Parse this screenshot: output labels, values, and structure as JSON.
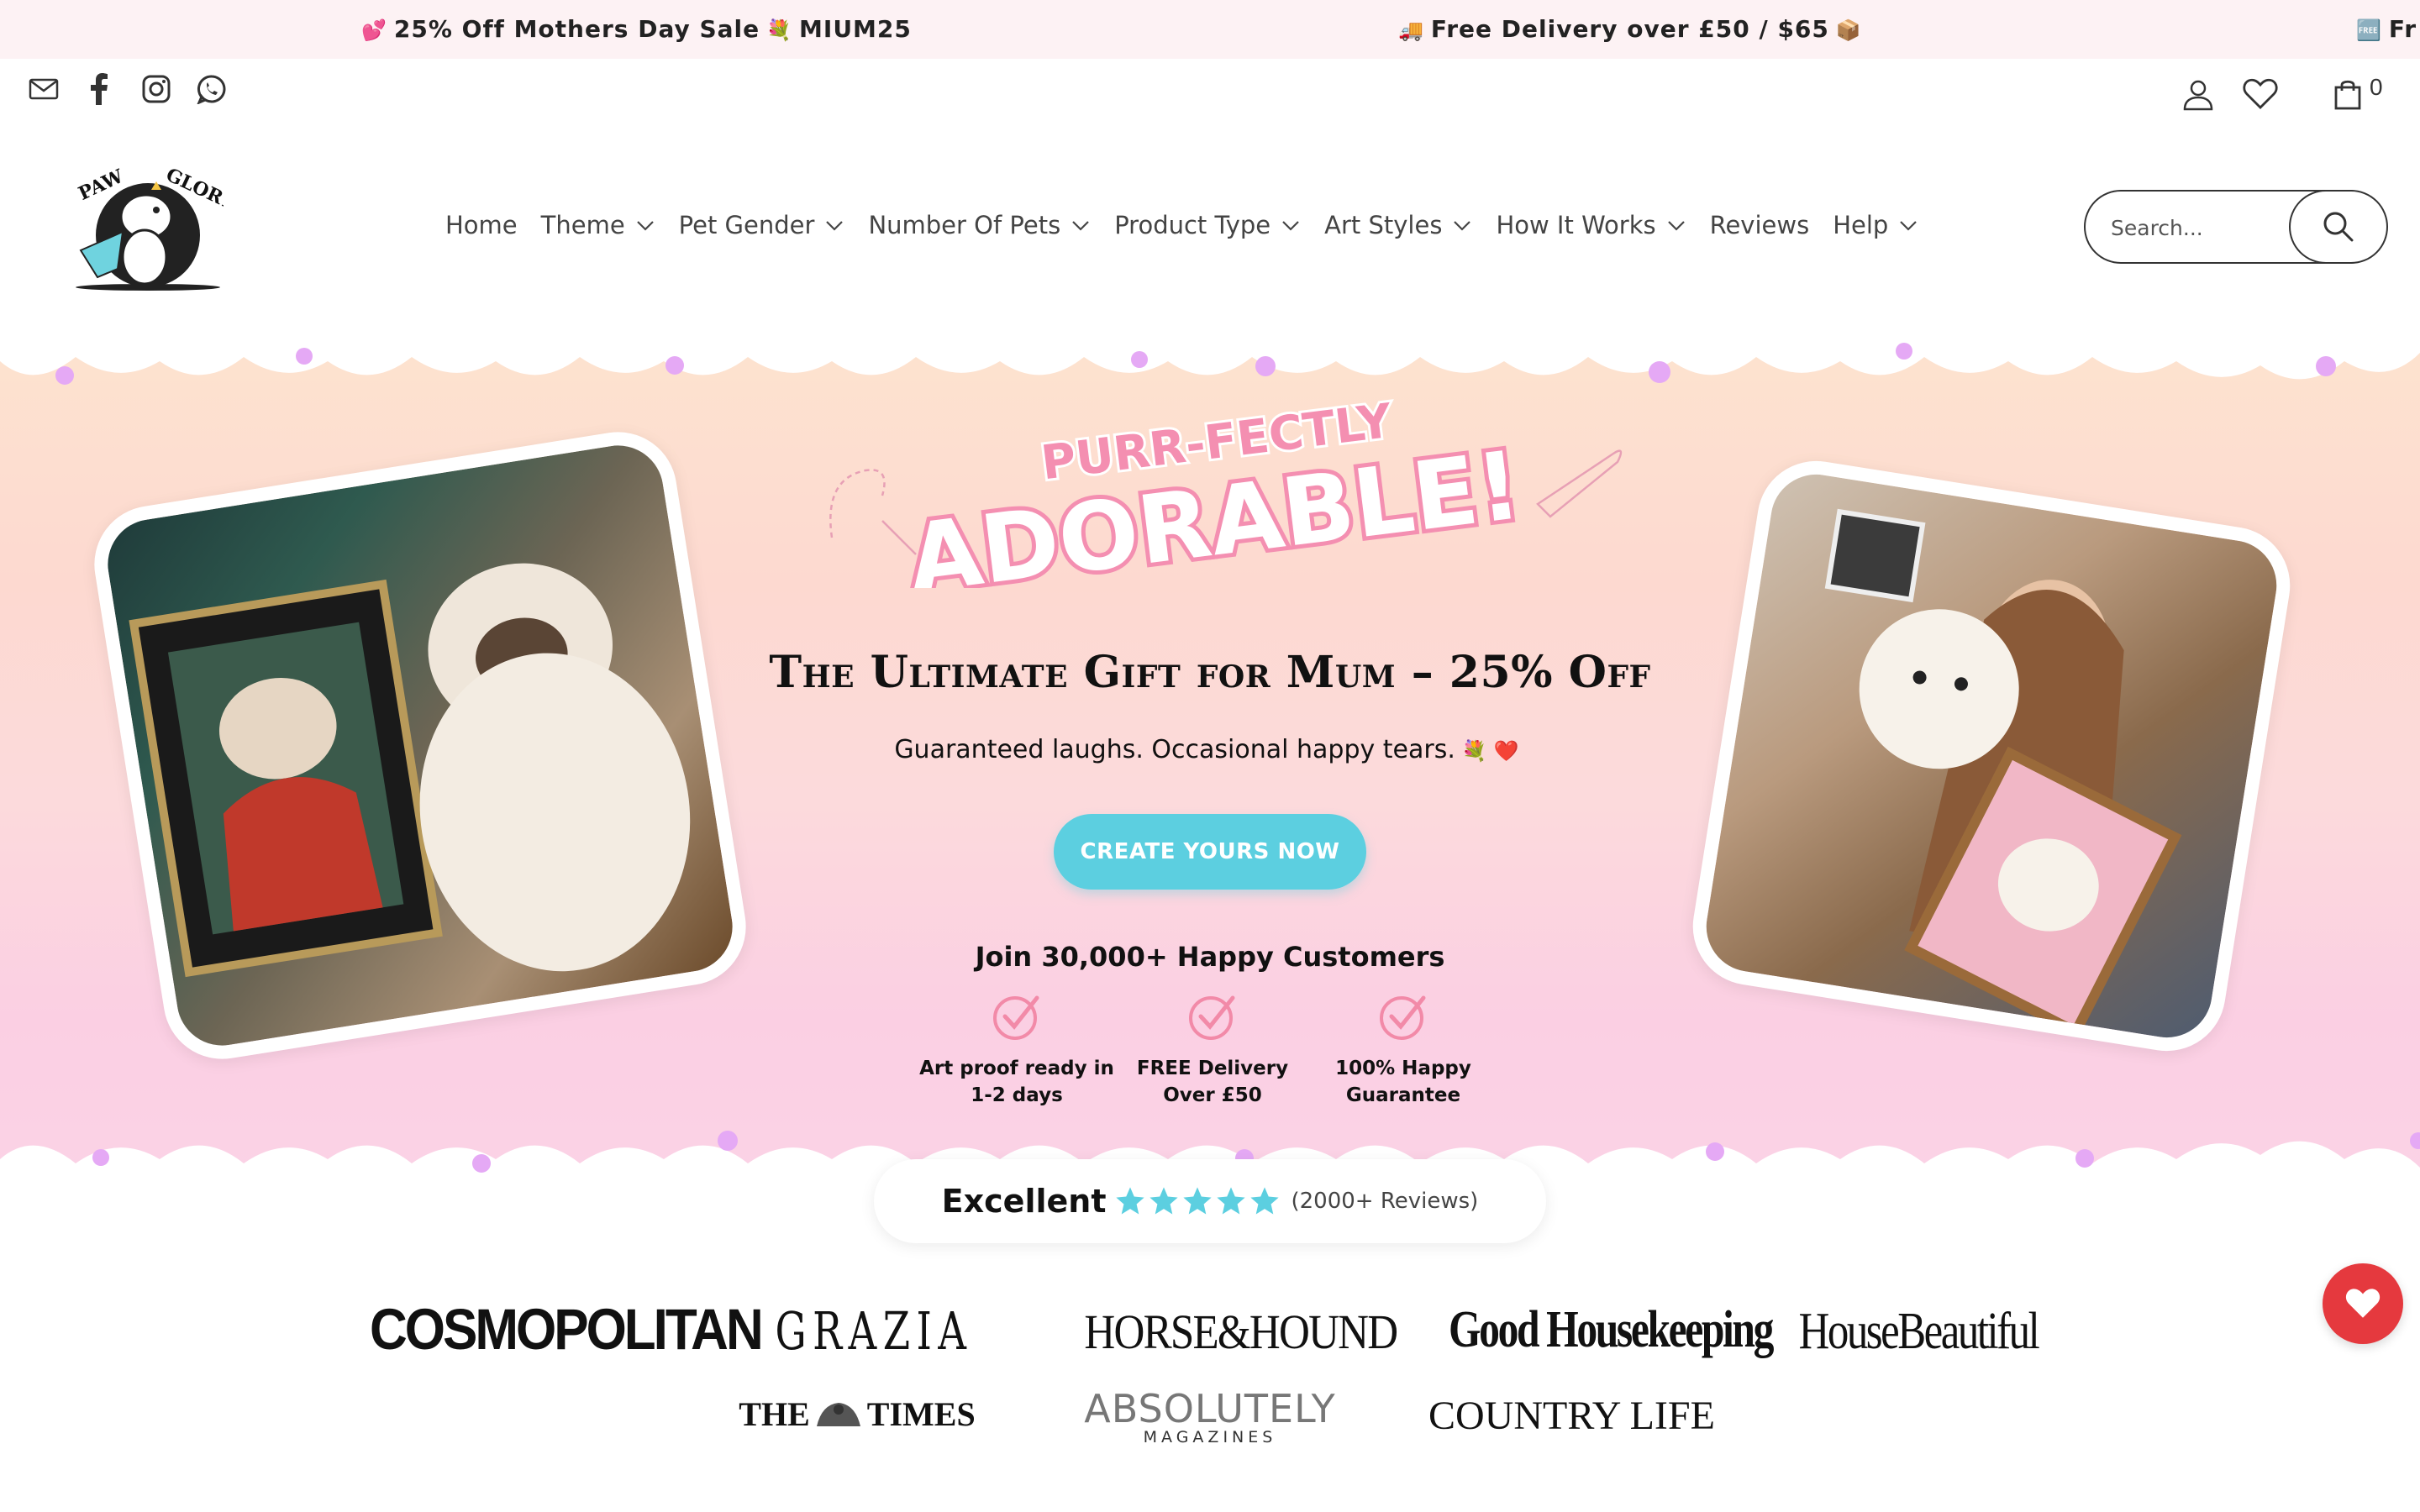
{
  "announcement": {
    "items": [
      {
        "lead_icon": "heart-gift-emoji",
        "text": "25% Off Mothers Day Sale",
        "trail_icon": "bouquet-emoji",
        "code": "MIUM25"
      },
      {
        "lead_icon": "delivery-truck-emoji",
        "text": "Free Delivery over £50 / $65",
        "trail_icon": "package-emoji"
      },
      {
        "lead_icon": "free-badge-emoji",
        "text": "Fr"
      }
    ]
  },
  "utility": {
    "social_icons": [
      "mail-icon",
      "facebook-icon",
      "instagram-icon",
      "whatsapp-icon"
    ],
    "cart_count": "0"
  },
  "brand": {
    "logo_text": "PAW & GLORY"
  },
  "nav": {
    "items": [
      {
        "label": "Home",
        "has_dropdown": false
      },
      {
        "label": "Theme",
        "has_dropdown": true
      },
      {
        "label": "Pet Gender",
        "has_dropdown": true
      },
      {
        "label": "Number Of Pets",
        "has_dropdown": true
      },
      {
        "label": "Product Type",
        "has_dropdown": true
      },
      {
        "label": "Art Styles",
        "has_dropdown": true
      },
      {
        "label": "How It Works",
        "has_dropdown": true
      },
      {
        "label": "Reviews",
        "has_dropdown": false
      },
      {
        "label": "Help",
        "has_dropdown": true
      }
    ]
  },
  "search": {
    "placeholder": "Search..."
  },
  "hero": {
    "art_top": "PURR-FECTLY",
    "art_main": "ADORABLE!",
    "headline": "The Ultimate Gift for Mum – 25% Off",
    "subhead": "Guaranteed laughs. Occasional happy tears.",
    "cta_label": "CREATE YOURS NOW",
    "join_text": "Join 30,000+ Happy Customers",
    "features": [
      {
        "line1": "Art proof ready in",
        "line2": "1-2 days"
      },
      {
        "line1": "FREE Delivery",
        "line2": "Over £50"
      },
      {
        "line1": "100% Happy",
        "line2": "Guarantee"
      }
    ]
  },
  "reviews": {
    "label": "Excellent",
    "rating": 5,
    "count_text": "(2000+ Reviews)"
  },
  "press": {
    "row1": [
      "COSMOPOLITAN",
      "GRAZIA",
      "HORSE&HOUND",
      "Good Housekeeping",
      "HouseBeautiful"
    ],
    "row2": [
      "THE",
      "TIMES",
      "ABSOLUTELY",
      "MAGAZINES",
      "COUNTRY LIFE"
    ]
  },
  "colors": {
    "announcement_bg": "#fdf2f4",
    "cta": "#5ccfe0",
    "stars": "#5ccfe0",
    "check": "#f28aa8",
    "adorable_pink": "#f48fb1",
    "wishlist_fab": "#e5393e"
  }
}
